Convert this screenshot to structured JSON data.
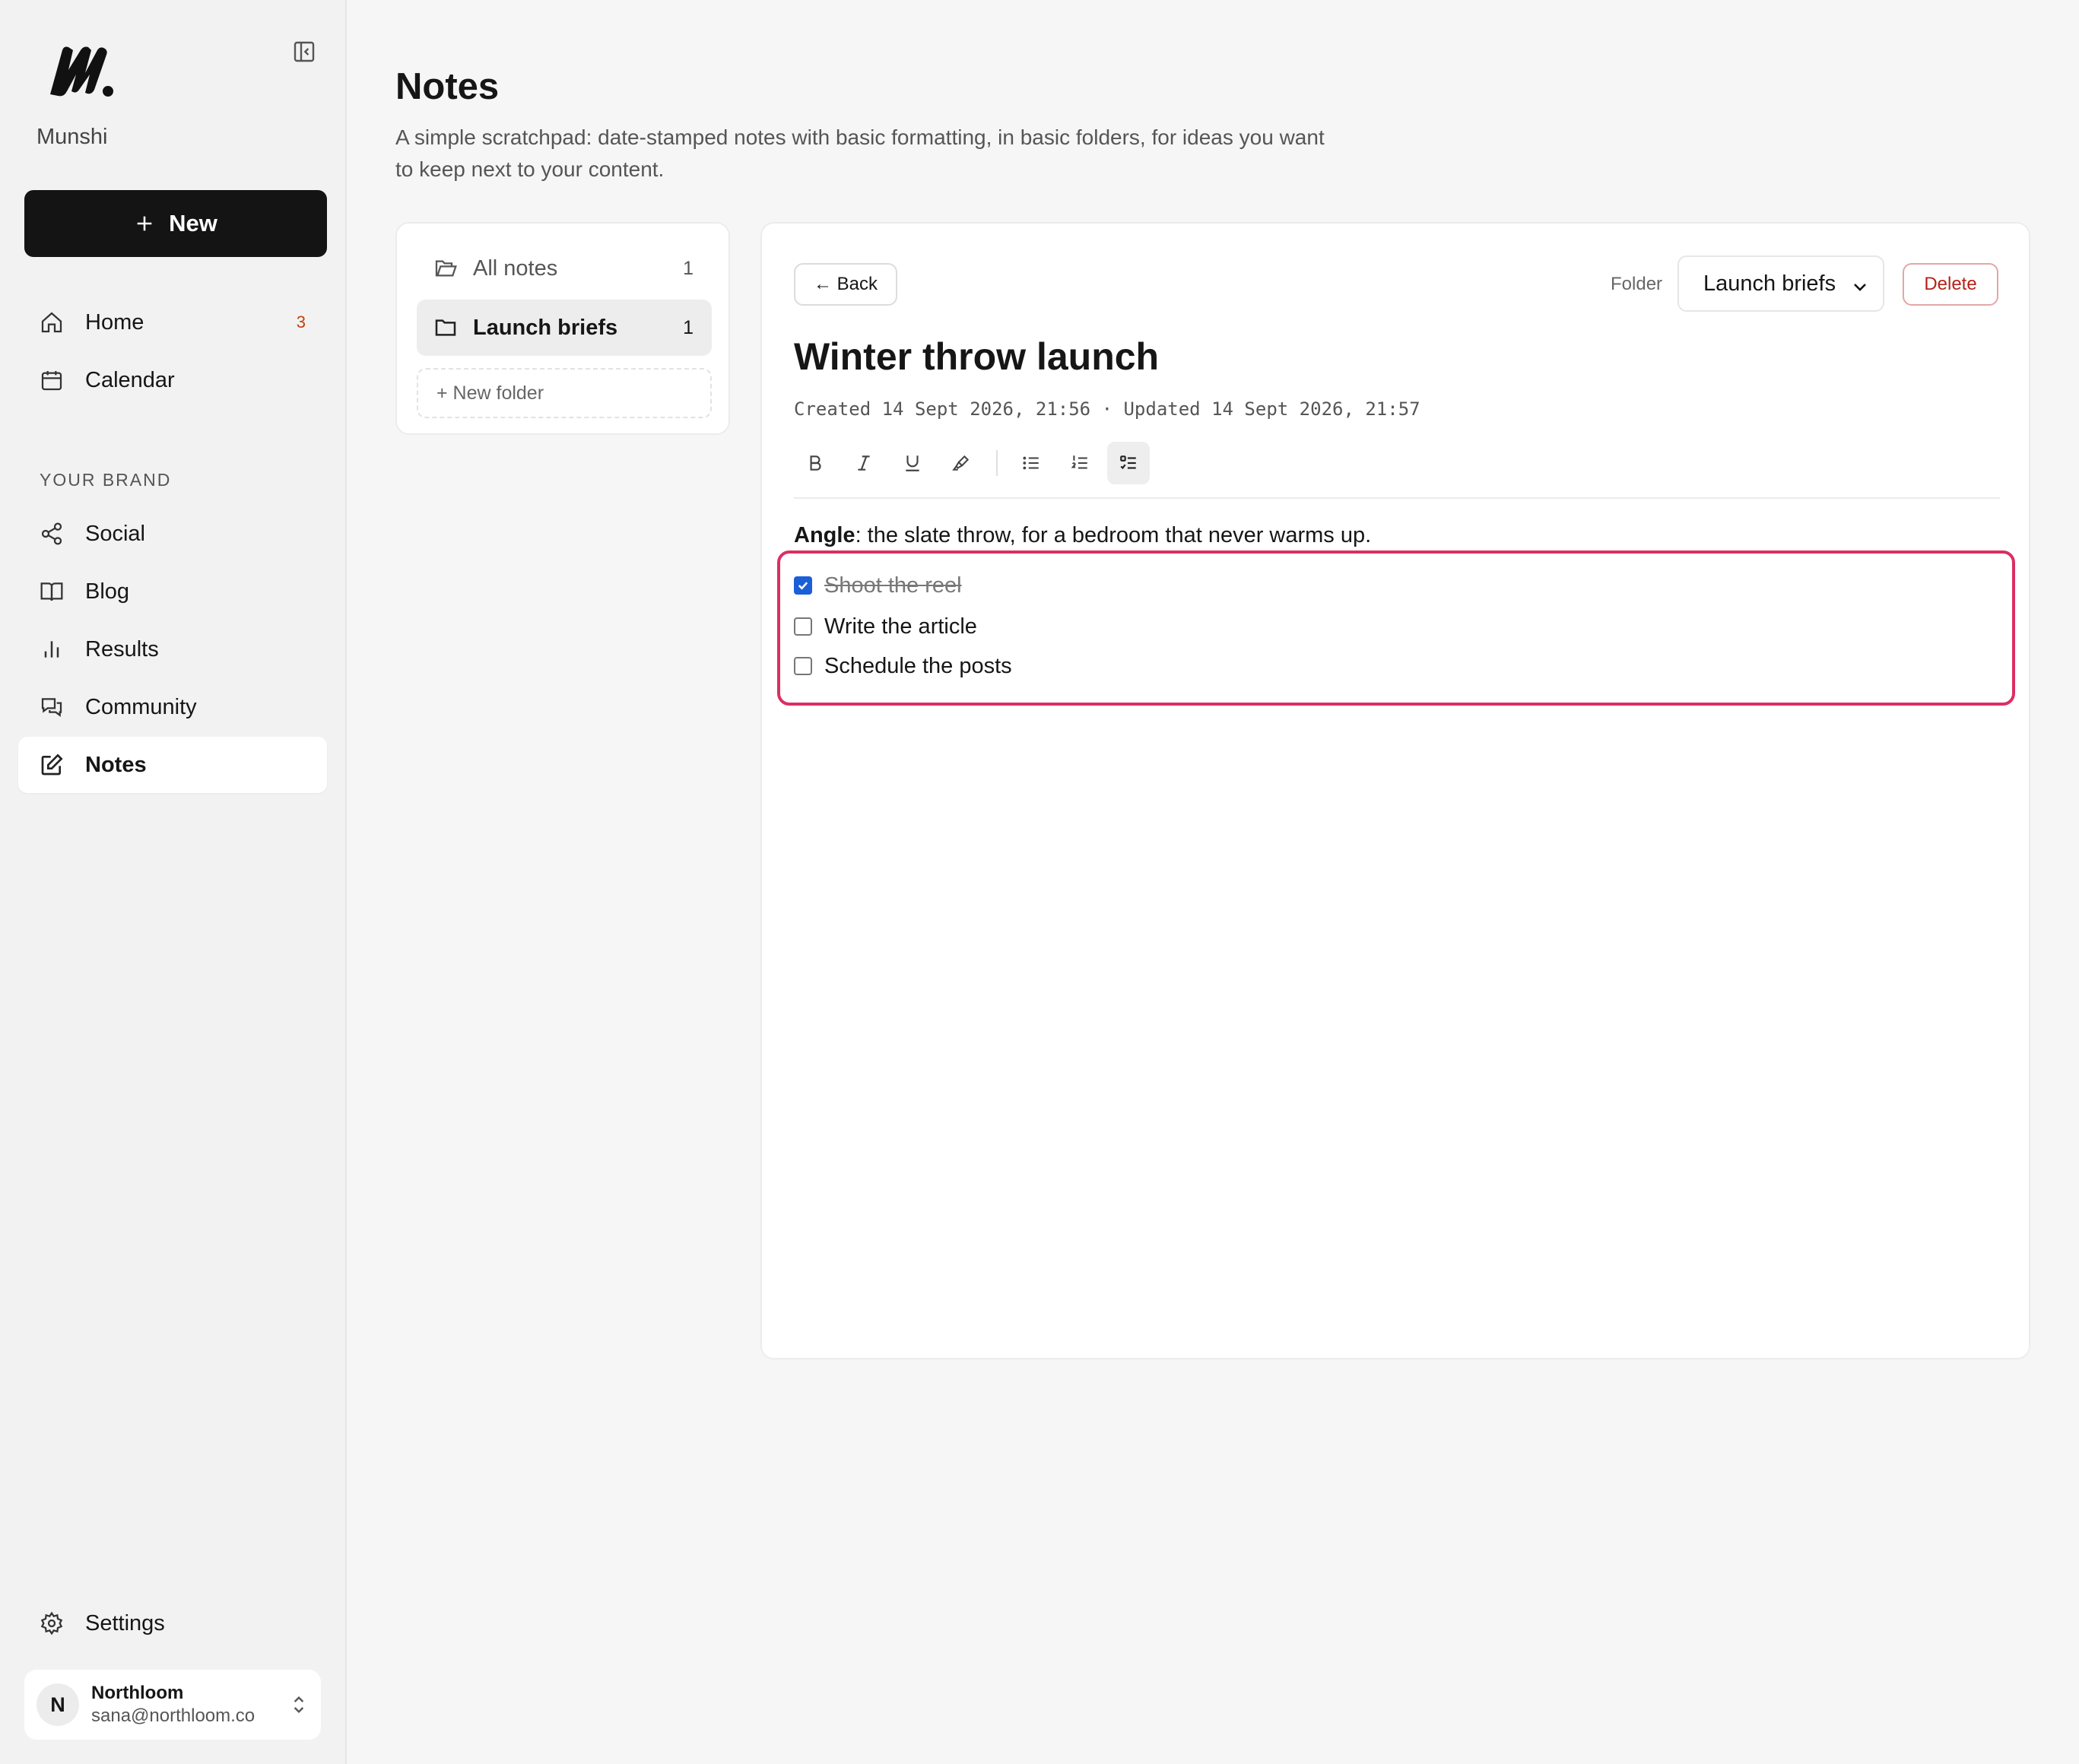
{
  "sidebar": {
    "brand_name": "Munshi",
    "new_button_label": "New",
    "primary_nav": [
      {
        "label": "Home",
        "badge": "3"
      },
      {
        "label": "Calendar"
      }
    ],
    "section_label": "YOUR BRAND",
    "brand_nav": [
      {
        "label": "Social"
      },
      {
        "label": "Blog"
      },
      {
        "label": "Results"
      },
      {
        "label": "Community"
      },
      {
        "label": "Notes",
        "active": true
      }
    ],
    "settings_label": "Settings",
    "account": {
      "initial": "N",
      "name": "Northloom",
      "email": "sana@northloom.co"
    }
  },
  "page": {
    "title": "Notes",
    "description": "A simple scratchpad: date-stamped notes with basic formatting, in basic folders, for ideas you want to keep next to your content."
  },
  "folders": {
    "items": [
      {
        "label": "All notes",
        "count": "1"
      },
      {
        "label": "Launch briefs",
        "count": "1",
        "active": true
      }
    ],
    "new_folder_label": "+ New folder"
  },
  "editor": {
    "back_label": "← Back",
    "folder_label": "Folder",
    "folder_selected": "Launch briefs",
    "delete_label": "Delete",
    "note_title": "Winter throw launch",
    "meta": "Created 14 Sept 2026, 21:56 · Updated 14 Sept 2026, 21:57",
    "toolbar": [
      "bold-icon",
      "italic-icon",
      "underline-icon",
      "highlight-icon",
      "bullet-list-icon",
      "numbered-list-icon",
      "checklist-icon"
    ],
    "body": {
      "angle_label": "Angle",
      "angle_text": ": the slate throw, for a bedroom that never warms up."
    },
    "checklist": [
      {
        "text": "Shoot the reel",
        "checked": true
      },
      {
        "text": "Write the article",
        "checked": false
      },
      {
        "text": "Schedule the posts",
        "checked": false
      }
    ]
  },
  "colors": {
    "accent_dark": "#141414",
    "highlight_border": "#db2f63",
    "checkbox_checked": "#1a5fd8",
    "delete_text": "#b42318",
    "badge": "#c2410c"
  }
}
